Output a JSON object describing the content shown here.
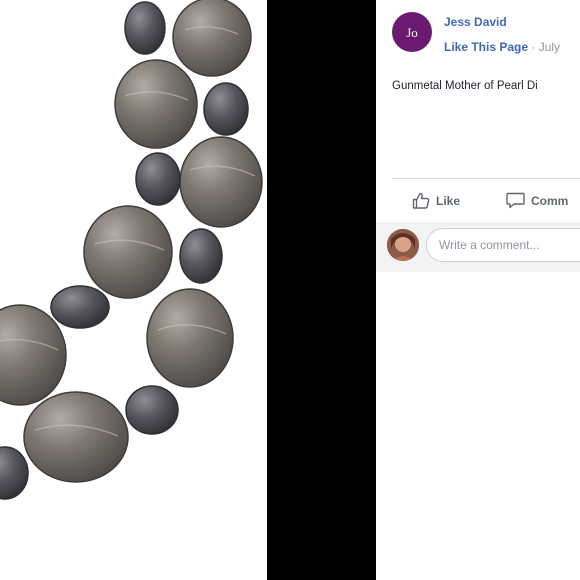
{
  "photo": {
    "subject": "gunmetal-mother-of-pearl-disc-necklace"
  },
  "post": {
    "avatar_icon": "page-logo-icon",
    "avatar_color": "#6a1b6f",
    "logo_mark": "Jo",
    "page_name": "Jess David",
    "like_page": "Like This Page",
    "separator": "·",
    "date": "July",
    "text": "Gunmetal Mother of Pearl Di",
    "actions": {
      "like": "Like",
      "comment": "Comm"
    },
    "comment_placeholder": "Write a comment..."
  },
  "colors": {
    "link": "#4267b2",
    "muted": "#90949c",
    "text": "#1d2129",
    "divider": "#000000"
  }
}
